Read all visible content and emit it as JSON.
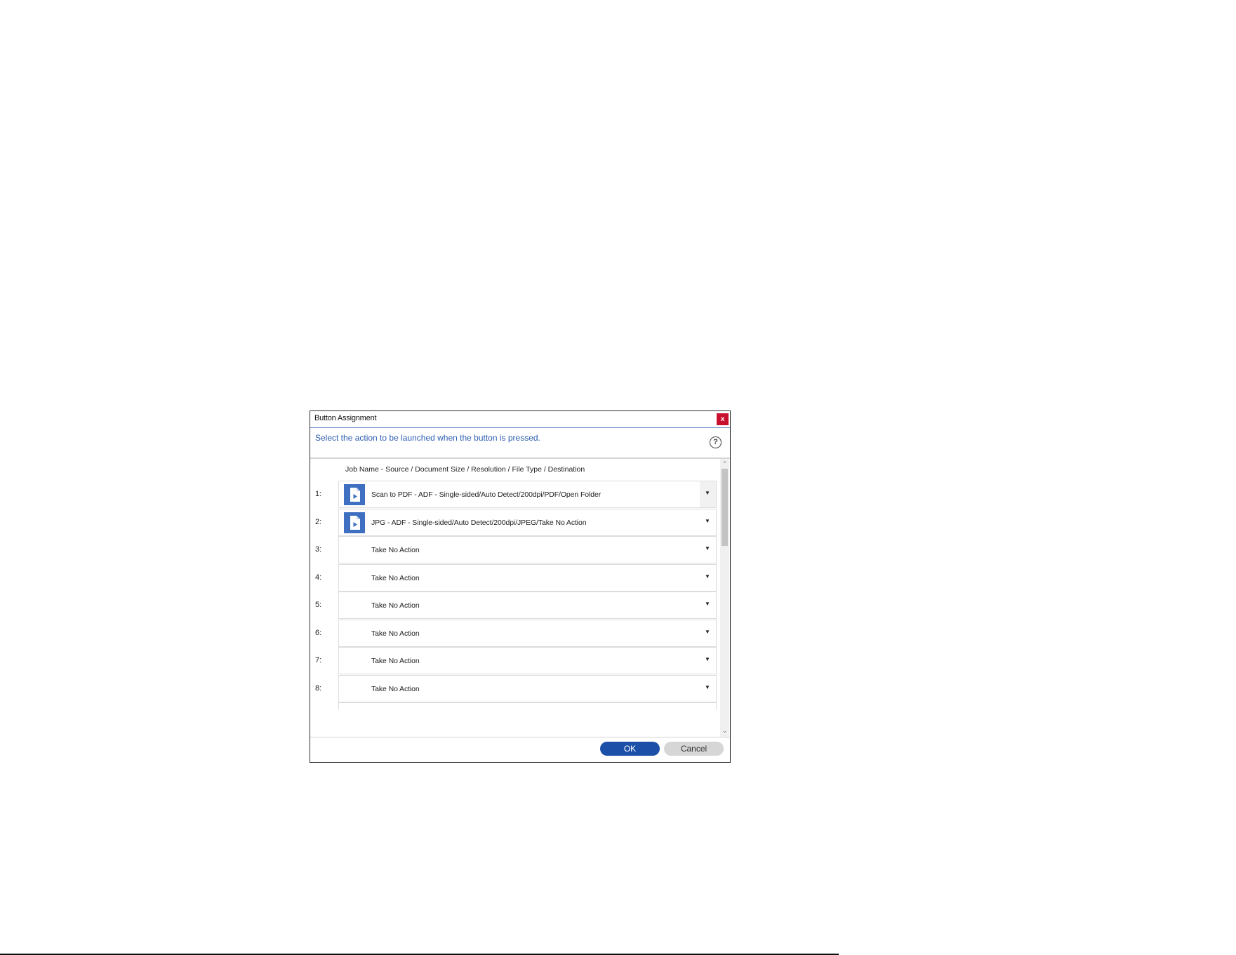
{
  "dialog": {
    "title": "Button Assignment",
    "close_label": "x",
    "instruction": "Select the action to be launched when the button is pressed.",
    "help_label": "?",
    "column_header": "Job Name  -  Source / Document Size / Resolution / File Type / Destination",
    "rows": [
      {
        "number": "1:",
        "value": "Scan to PDF - ADF - Single-sided/Auto Detect/200dpi/PDF/Open Folder",
        "icon": "scan-job-icon"
      },
      {
        "number": "2:",
        "value": "JPG - ADF - Single-sided/Auto Detect/200dpi/JPEG/Take No Action",
        "icon": "scan-job-icon"
      },
      {
        "number": "3:",
        "value": "Take No Action",
        "icon": ""
      },
      {
        "number": "4:",
        "value": "Take No Action",
        "icon": ""
      },
      {
        "number": "5:",
        "value": "Take No Action",
        "icon": ""
      },
      {
        "number": "6:",
        "value": "Take No Action",
        "icon": ""
      },
      {
        "number": "7:",
        "value": "Take No Action",
        "icon": ""
      },
      {
        "number": "8:",
        "value": "Take No Action",
        "icon": ""
      }
    ],
    "dropdown_arrow": "▼",
    "ok_label": "OK",
    "cancel_label": "Cancel",
    "colors": {
      "accent": "#1c4fa8",
      "instruction_text": "#2a5db0",
      "icon_bg": "#3f6fc0",
      "close_bg": "#c8102e"
    }
  }
}
